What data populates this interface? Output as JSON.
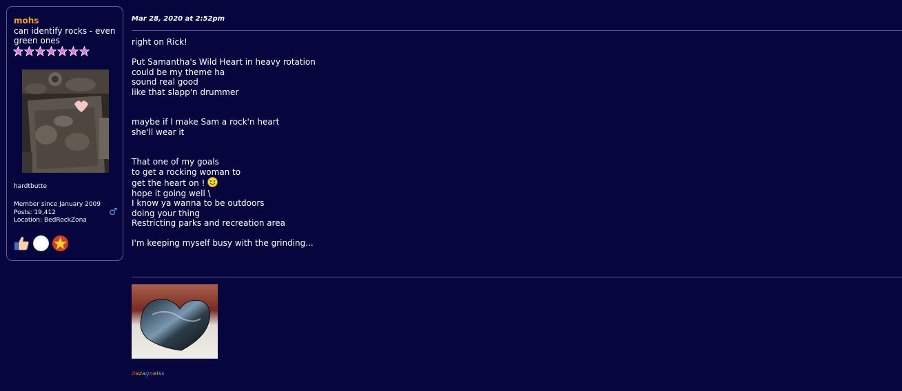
{
  "profile": {
    "username": "mohs",
    "user_title": "can identify rocks - even green ones",
    "star_count": 7,
    "star_icon": "pink-star-icon",
    "avatar_icon": "rock-heart-avatar",
    "avatar_caption": "hardtbutte",
    "member_since": "Member since January 2009",
    "posts": "Posts: 19,412",
    "location": "Location: BedRockZona",
    "gender_icon": "male-symbol-icon",
    "gender_symbol": "♂",
    "badges": [
      "thumbs-up-icon",
      "white-circle-icon",
      "gold-star-icon"
    ]
  },
  "post": {
    "date": "Mar 28, 2020 at 2:52pm",
    "message_lines": [
      "right on Rick!",
      "",
      "Put Samantha's Wild Heart in heavy rotation",
      "could be my theme ha",
      "sound real good",
      "like that slapp'n drummer",
      "",
      "",
      "maybe if I make Sam a rock'n heart",
      "she'll wear it",
      "",
      "",
      "That one of my goals",
      "to get a rocking woman to",
      "get the heart on ! "
    ],
    "smiley_icon": "smiley-face-icon",
    "message_lines_2": [
      "",
      "hope it going well \\",
      "I know ya wanna to be outdoors",
      "doing your thing",
      "Restricting parks and recreation area",
      "",
      "I'm keeping myself busy with the grinding..."
    ]
  },
  "signature": {
    "image_icon": "polished-stone-heart-image",
    "text_letters": [
      "d",
      "a",
      "z",
      "a",
      "g",
      "n",
      "e",
      "i",
      "s",
      "s"
    ],
    "text_colors": [
      "#e04a2a",
      "#ff8c1a",
      "#f0c020",
      "#7ad04a",
      "#4a90e0",
      "#b070e0",
      "#ff9a50",
      "#f0d040",
      "#70d0a0",
      "#c070f0"
    ]
  }
}
